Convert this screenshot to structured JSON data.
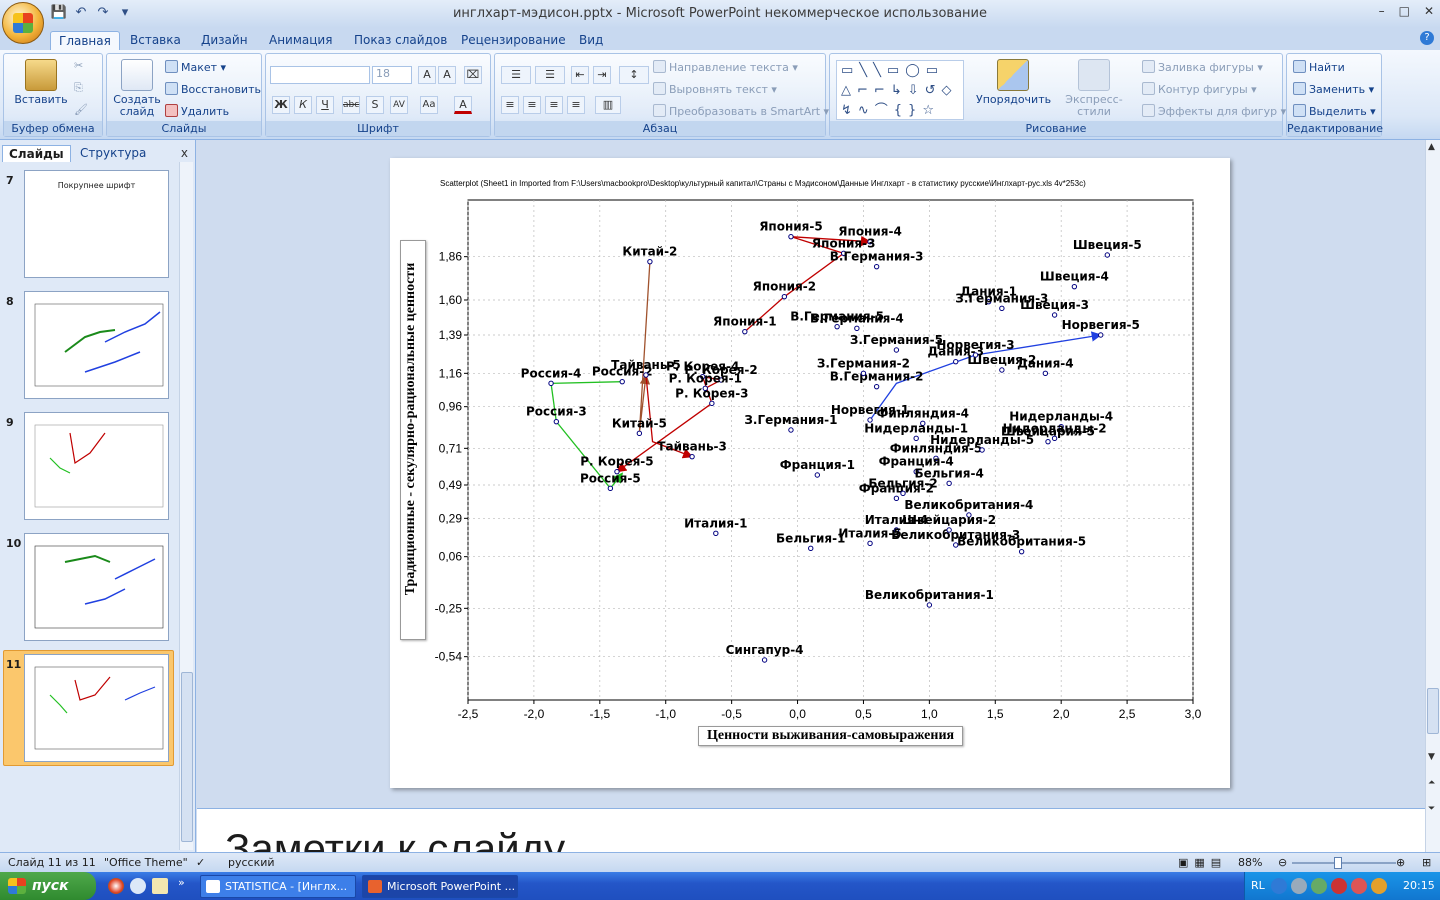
{
  "window": {
    "title": "инглхарт-мэдисон.pptx - Microsoft PowerPoint некоммерческое использование",
    "controls": [
      "–",
      "□",
      "✕"
    ]
  },
  "ribbon_tabs": [
    "Главная",
    "Вставка",
    "Дизайн",
    "Анимация",
    "Показ слайдов",
    "Рецензирование",
    "Вид"
  ],
  "ribbon": {
    "clipboard": {
      "paste": "Вставить",
      "name": "Буфер обмена"
    },
    "slides": {
      "new_slide": "Создать слайд",
      "layout": "Макет",
      "reset": "Восстановить",
      "delete": "Удалить",
      "name": "Слайды"
    },
    "font": {
      "size": "18",
      "name": "Шрифт",
      "buttons": [
        "Ж",
        "К",
        "Ч",
        "abc",
        "S",
        "AV",
        "Aa",
        "A"
      ]
    },
    "paragraph": {
      "text_direction": "Направление текста",
      "align_text": "Выровнять текст",
      "smartart": "Преобразовать в SmartArt",
      "name": "Абзац"
    },
    "drawing": {
      "arrange": "Упорядочить",
      "quick_styles": "Экспресс-стили",
      "fill": "Заливка фигуры",
      "outline": "Контур фигуры",
      "effects": "Эффекты для фигур",
      "name": "Рисование"
    },
    "editing": {
      "find": "Найти",
      "replace": "Заменить",
      "select": "Выделить",
      "name": "Редактирование"
    }
  },
  "panel": {
    "tabs": [
      "Слайды",
      "Структура"
    ],
    "close": "x",
    "slides": [
      {
        "num": "7",
        "title": "Покрупнее шрифт"
      },
      {
        "num": "8",
        "title": ""
      },
      {
        "num": "9",
        "title": ""
      },
      {
        "num": "10",
        "title": ""
      },
      {
        "num": "11",
        "title": ""
      }
    ]
  },
  "notes_placeholder": "Заметки к слайду",
  "status": {
    "slide": "Слайд 11 из 11",
    "theme": "\"Office Theme\"",
    "lang": "русский",
    "zoom": "88%"
  },
  "taskbar": {
    "start": "пуск",
    "buttons": [
      "STATISTICA - [Инглх...",
      "Microsoft PowerPoint ..."
    ],
    "lang": "RL",
    "time": "20:15"
  },
  "colors": {
    "red": "#c00000",
    "green": "#22c022",
    "blue": "#2040e0",
    "brown": "#a0522d",
    "point": "#000080"
  },
  "chart_data": {
    "type": "scatter",
    "title": "Scatterplot (Sheet1 in Imported from F:\\Users\\macbookpro\\Desktop\\культурный капитал\\Страны с Мэдисоном\\Данные Инглхарт - в статистику русские\\Инглхарт-рус.xls 4v*253c)",
    "xlabel": "Ценности выживания-самовыражения",
    "ylabel": "Традиционные - секулярно-рациональные ценности",
    "xlim": [
      -2.5,
      3.0
    ],
    "ylim": [
      -0.8,
      2.2
    ],
    "xticks": [
      "-2,5",
      "-2,0",
      "-1,5",
      "-1,0",
      "-0,5",
      "0,0",
      "0,5",
      "1,0",
      "1,5",
      "2,0",
      "2,5",
      "3,0"
    ],
    "yticks": [
      {
        "v": 1.86,
        "label": "1,86"
      },
      {
        "v": 1.6,
        "label": "1,60"
      },
      {
        "v": 1.39,
        "label": "1,39"
      },
      {
        "v": 1.16,
        "label": "1,16"
      },
      {
        "v": 0.96,
        "label": "0,96"
      },
      {
        "v": 0.71,
        "label": "0,71"
      },
      {
        "v": 0.49,
        "label": "0,49"
      },
      {
        "v": 0.29,
        "label": "0,29"
      },
      {
        "v": 0.06,
        "label": "0,06"
      },
      {
        "v": -0.25,
        "label": "-0,25"
      },
      {
        "v": -0.54,
        "label": "-0,54"
      }
    ],
    "points": [
      {
        "label": "Япония-5",
        "x": -0.05,
        "y": 1.98
      },
      {
        "label": "Япония-4",
        "x": 0.55,
        "y": 1.95
      },
      {
        "label": "Япония-3",
        "x": 0.35,
        "y": 1.88
      },
      {
        "label": "Япония-2",
        "x": -0.1,
        "y": 1.62
      },
      {
        "label": "Япония-1",
        "x": -0.4,
        "y": 1.41
      },
      {
        "label": "Китай-2",
        "x": -1.12,
        "y": 1.83
      },
      {
        "label": "В.Германия-3",
        "x": 0.6,
        "y": 1.8
      },
      {
        "label": "В.Германия-5",
        "x": 0.3,
        "y": 1.44
      },
      {
        "label": "В.Германия-4",
        "x": 0.45,
        "y": 1.43
      },
      {
        "label": "В.Германия-2",
        "x": 0.6,
        "y": 1.08
      },
      {
        "label": "Швеция-5",
        "x": 2.35,
        "y": 1.87
      },
      {
        "label": "Швеция-4",
        "x": 2.1,
        "y": 1.68
      },
      {
        "label": "Швеция-3",
        "x": 1.95,
        "y": 1.51
      },
      {
        "label": "Швеция-2",
        "x": 1.55,
        "y": 1.18
      },
      {
        "label": "Дания-1",
        "x": 1.45,
        "y": 1.59
      },
      {
        "label": "Дания-4",
        "x": 1.88,
        "y": 1.16
      },
      {
        "label": "Дания-3",
        "x": 1.2,
        "y": 1.23
      },
      {
        "label": "З.Германия-3",
        "x": 1.55,
        "y": 1.55
      },
      {
        "label": "З.Германия-5",
        "x": 0.75,
        "y": 1.3
      },
      {
        "label": "З.Германия-2",
        "x": 0.5,
        "y": 1.16
      },
      {
        "label": "З.Германия-1",
        "x": -0.05,
        "y": 0.82
      },
      {
        "label": "Норвегия-5",
        "x": 2.3,
        "y": 1.39
      },
      {
        "label": "Норвегия-3",
        "x": 1.35,
        "y": 1.27
      },
      {
        "label": "Норвегия-1",
        "x": 0.55,
        "y": 0.88
      },
      {
        "label": "Россия-4",
        "x": -1.87,
        "y": 1.1
      },
      {
        "label": "Россия-2",
        "x": -1.33,
        "y": 1.11
      },
      {
        "label": "Россия-3",
        "x": -1.83,
        "y": 0.87
      },
      {
        "label": "Россия-5",
        "x": -1.42,
        "y": 0.47
      },
      {
        "label": "Тайвань-5",
        "x": -1.15,
        "y": 1.15
      },
      {
        "label": "Тайвань-3",
        "x": -0.8,
        "y": 0.66
      },
      {
        "label": "Китай-5",
        "x": -1.2,
        "y": 0.8
      },
      {
        "label": "Р. Корея-4",
        "x": -0.72,
        "y": 1.14
      },
      {
        "label": "Р. Корея-2",
        "x": -0.58,
        "y": 1.12
      },
      {
        "label": "Р. Корея-1",
        "x": -0.7,
        "y": 1.07
      },
      {
        "label": "Р. Корея-3",
        "x": -0.65,
        "y": 0.98
      },
      {
        "label": "Р. Корея-5",
        "x": -1.37,
        "y": 0.57
      },
      {
        "label": "Финляндия-4",
        "x": 0.95,
        "y": 0.86
      },
      {
        "label": "Финляндия-5",
        "x": 1.05,
        "y": 0.65
      },
      {
        "label": "Нидерланды-4",
        "x": 2.0,
        "y": 0.84
      },
      {
        "label": "Нидерланды-2",
        "x": 1.95,
        "y": 0.77
      },
      {
        "label": "Нидерланды-1",
        "x": 0.9,
        "y": 0.77
      },
      {
        "label": "Нидерланды-5",
        "x": 1.4,
        "y": 0.7
      },
      {
        "label": "Швейцария-5",
        "x": 1.9,
        "y": 0.75
      },
      {
        "label": "Франция-1",
        "x": 0.15,
        "y": 0.55
      },
      {
        "label": "Франция-4",
        "x": 0.9,
        "y": 0.57
      },
      {
        "label": "Франция-2",
        "x": 0.75,
        "y": 0.41
      },
      {
        "label": "Бельгия-4",
        "x": 1.15,
        "y": 0.5
      },
      {
        "label": "Бельгия-2",
        "x": 0.8,
        "y": 0.44
      },
      {
        "label": "Бельгия-1",
        "x": 0.1,
        "y": 0.11
      },
      {
        "label": "Великобритания-4",
        "x": 1.3,
        "y": 0.31
      },
      {
        "label": "Великобритания-3",
        "x": 1.2,
        "y": 0.13
      },
      {
        "label": "Великобритания-5",
        "x": 1.7,
        "y": 0.09
      },
      {
        "label": "Великобритания-1",
        "x": 1.0,
        "y": -0.23
      },
      {
        "label": "Италия-1",
        "x": -0.62,
        "y": 0.2
      },
      {
        "label": "Италия-4",
        "x": 0.75,
        "y": 0.22
      },
      {
        "label": "Италия-5",
        "x": 0.55,
        "y": 0.14
      },
      {
        "label": "Швейцария-2",
        "x": 1.15,
        "y": 0.22
      },
      {
        "label": "Сингапур-4",
        "x": -0.25,
        "y": -0.56
      }
    ],
    "arrows": [
      {
        "color": "red",
        "path": [
          [
            -0.4,
            1.41
          ],
          [
            -0.1,
            1.62
          ],
          [
            0.35,
            1.88
          ],
          [
            -0.05,
            1.98
          ],
          [
            0.55,
            1.95
          ]
        ]
      },
      {
        "color": "brown",
        "path": [
          [
            -1.12,
            1.83
          ],
          [
            -1.2,
            0.8
          ],
          [
            -1.15,
            1.15
          ]
        ]
      },
      {
        "color": "red",
        "path": [
          [
            -1.15,
            1.15
          ],
          [
            -1.1,
            0.75
          ],
          [
            -0.8,
            0.66
          ]
        ]
      },
      {
        "color": "red",
        "path": [
          [
            -0.7,
            1.07
          ],
          [
            -0.58,
            1.12
          ],
          [
            -0.72,
            1.14
          ],
          [
            -0.65,
            0.98
          ],
          [
            -1.37,
            0.57
          ]
        ]
      },
      {
        "color": "green",
        "path": [
          [
            -1.33,
            1.11
          ],
          [
            -1.87,
            1.1
          ],
          [
            -1.83,
            0.87
          ],
          [
            -1.42,
            0.47
          ],
          [
            -1.33,
            0.56
          ]
        ]
      },
      {
        "color": "blue",
        "path": [
          [
            0.55,
            0.88
          ],
          [
            0.75,
            1.1
          ],
          [
            1.35,
            1.27
          ],
          [
            2.3,
            1.39
          ]
        ]
      }
    ]
  }
}
